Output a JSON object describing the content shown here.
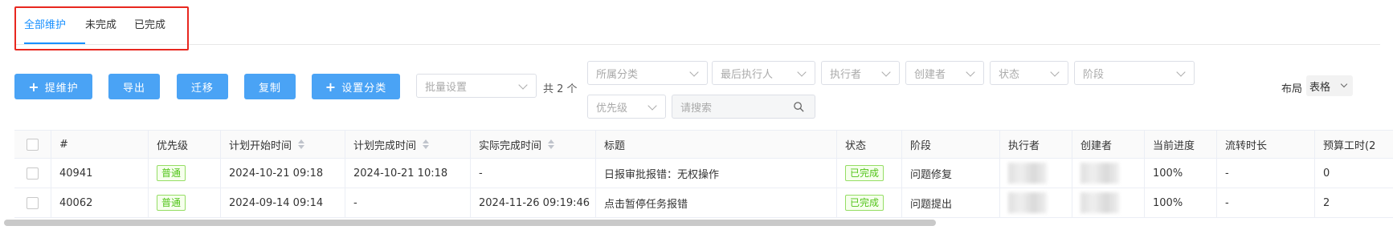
{
  "tabs": [
    {
      "label": "全部维护",
      "active": true
    },
    {
      "label": "未完成",
      "active": false
    },
    {
      "label": "已完成",
      "active": false
    }
  ],
  "toolbar": {
    "add_label": "提维护",
    "export_label": "导出",
    "migrate_label": "迁移",
    "copy_label": "复制",
    "set_category_label": "设置分类",
    "batch_placeholder": "批量设置",
    "total_text": "共 2 个",
    "filters": {
      "category": "所属分类",
      "last_executor": "最后执行人",
      "executor": "执行者",
      "creator": "创建者",
      "status": "状态",
      "stage": "阶段",
      "priority": "优先级"
    },
    "search_placeholder": "请搜索",
    "layout_label": "布局",
    "layout_value": "表格"
  },
  "colors": {
    "accent": "#1890ff",
    "button": "#4aa3f5",
    "done_tag": "#52c41a",
    "highlight": "#e8271f"
  },
  "table": {
    "headers": {
      "id": "#",
      "priority": "优先级",
      "plan_start": "计划开始时间",
      "plan_end": "计划完成时间",
      "actual_end": "实际完成时间",
      "title": "标题",
      "status": "状态",
      "stage": "阶段",
      "executor": "执行者",
      "creator": "创建者",
      "progress": "当前进度",
      "flow_duration": "流转时长",
      "budget_hours": "预算工时(2"
    },
    "rows": [
      {
        "id": "40941",
        "priority": "普通",
        "plan_start": "2024-10-21 09:18",
        "plan_end": "2024-10-21 10:18",
        "actual_end": "-",
        "title": "日报审批报错：无权操作",
        "status": "已完成",
        "stage": "问题修复",
        "progress": "100%",
        "flow_duration": "-",
        "budget_hours": "0"
      },
      {
        "id": "40062",
        "priority": "普通",
        "plan_start": "2024-09-14 09:14",
        "plan_end": "-",
        "actual_end": "2024-11-26 09:19:46",
        "title": "点击暂停任务报错",
        "status": "已完成",
        "stage": "问题提出",
        "progress": "100%",
        "flow_duration": "-",
        "budget_hours": "2"
      }
    ]
  }
}
